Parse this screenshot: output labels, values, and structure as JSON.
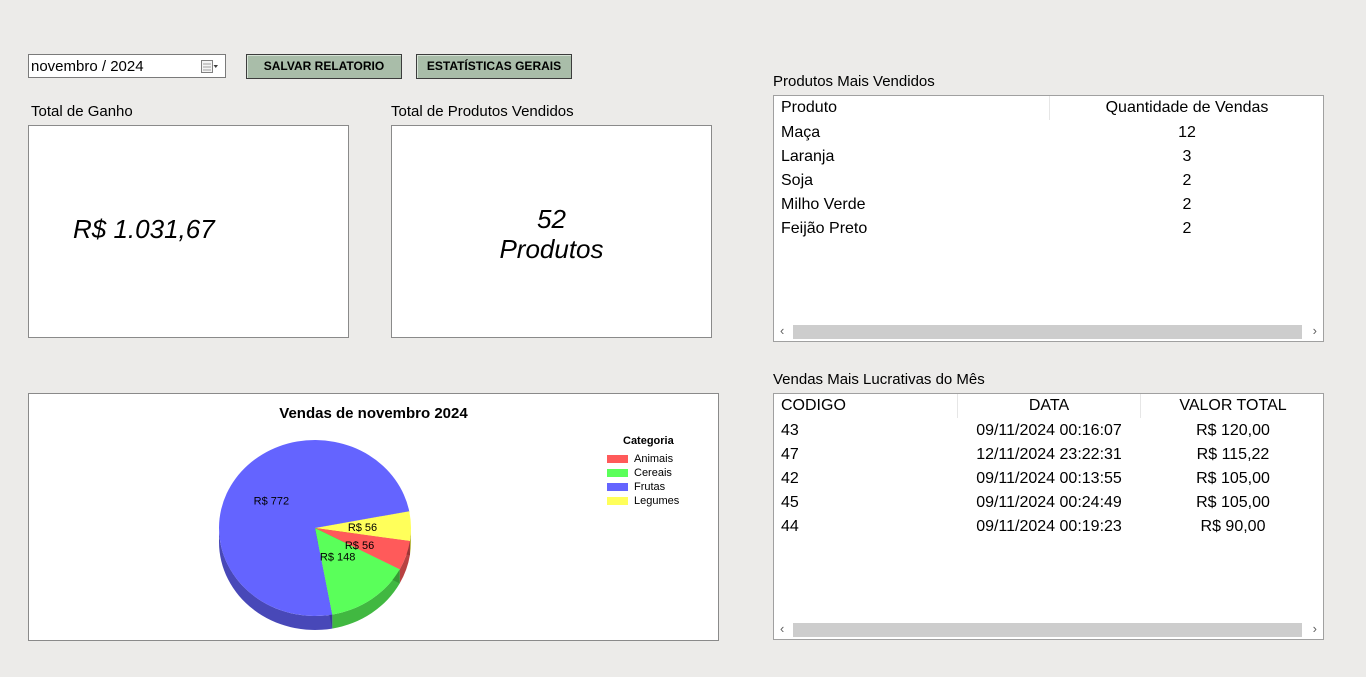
{
  "toolbar": {
    "date_value": "novembro / 2024",
    "save_label": "SALVAR RELATORIO",
    "stats_label": "ESTATÍSTICAS GERAIS"
  },
  "cards": {
    "total_ganho_label": "Total de Ganho",
    "total_ganho_value": "R$ 1.031,67",
    "total_produtos_label": "Total de Produtos Vendidos",
    "total_produtos_line1": "52",
    "total_produtos_line2": "Produtos"
  },
  "top_products": {
    "title": "Produtos Mais Vendidos",
    "columns": [
      "Produto",
      "Quantidade de Vendas"
    ],
    "rows": [
      [
        "Maça",
        "12"
      ],
      [
        "Laranja",
        "3"
      ],
      [
        "Soja",
        "2"
      ],
      [
        "Milho Verde",
        "2"
      ],
      [
        "Feijão Preto",
        "2"
      ]
    ]
  },
  "top_sales": {
    "title": "Vendas Mais Lucrativas do Mês",
    "columns": [
      "CODIGO",
      "DATA",
      "VALOR TOTAL"
    ],
    "rows": [
      [
        "43",
        "09/11/2024 00:16:07",
        "R$ 120,00"
      ],
      [
        "47",
        "12/11/2024 23:22:31",
        "R$ 115,22"
      ],
      [
        "42",
        "09/11/2024 00:13:55",
        "R$ 105,00"
      ],
      [
        "45",
        "09/11/2024 00:24:49",
        "R$ 105,00"
      ],
      [
        "44",
        "09/11/2024 00:19:23",
        "R$ 90,00"
      ]
    ]
  },
  "chart_data": {
    "type": "pie",
    "title": "Vendas de novembro 2024",
    "legend_title": "Categoria",
    "legend_position": "right",
    "categories": [
      "Animais",
      "Cereais",
      "Frutas",
      "Legumes"
    ],
    "values": [
      56,
      148,
      772,
      56
    ],
    "labels": [
      "R$ 56",
      "R$ 148",
      "R$ 772",
      "R$ 56"
    ],
    "colors": [
      "#ff5a5a",
      "#5aff5a",
      "#6464ff",
      "#ffff5a"
    ]
  },
  "icons": {
    "calendar": "calendar-icon",
    "scroll_left": "‹",
    "scroll_right": "›"
  }
}
